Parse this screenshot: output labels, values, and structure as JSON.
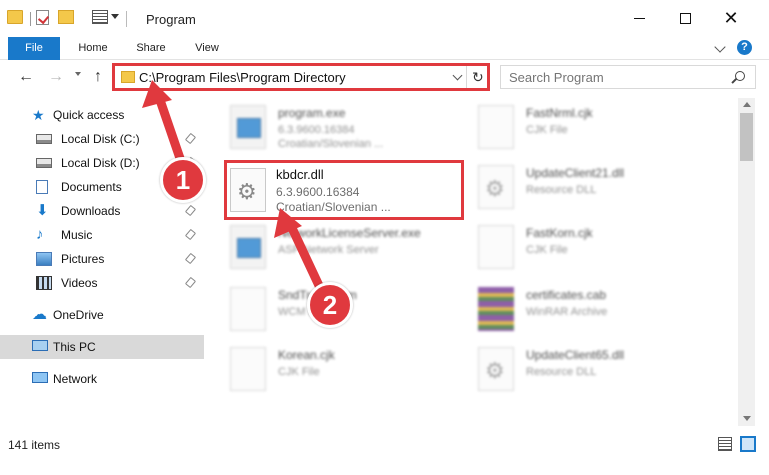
{
  "window": {
    "title": "Program",
    "minimize_glyph": "",
    "close_glyph": "✕"
  },
  "ribbon": {
    "tabs": [
      "File",
      "Home",
      "Share",
      "View"
    ],
    "help_glyph": "?"
  },
  "nav": {
    "back_glyph": "←",
    "forward_glyph": "→",
    "up_glyph": "↑",
    "address": "C:\\Program Files\\Program Directory",
    "refresh_glyph": "↻",
    "search_placeholder": "Search Program"
  },
  "sidebar": {
    "items": [
      {
        "label": "Quick access",
        "icon": "star-icon"
      },
      {
        "label": "Local Disk (C:)",
        "icon": "disk-icon"
      },
      {
        "label": "Local Disk (D:)",
        "icon": "disk-icon"
      },
      {
        "label": "Documents",
        "icon": "documents-icon"
      },
      {
        "label": "Downloads",
        "icon": "downloads-icon"
      },
      {
        "label": "Music",
        "icon": "music-icon"
      },
      {
        "label": "Pictures",
        "icon": "pictures-icon"
      },
      {
        "label": "Videos",
        "icon": "videos-icon"
      },
      {
        "label": "OneDrive",
        "icon": "onedrive-icon"
      },
      {
        "label": "This PC",
        "icon": "pc-icon"
      },
      {
        "label": "Network",
        "icon": "network-icon"
      }
    ]
  },
  "files": {
    "highlighted": {
      "name": "kbdcr.dll",
      "version": "6.3.9600.16384",
      "description": "Croatian/Slovenian ..."
    },
    "left": [
      {
        "name": "program.exe",
        "meta": "6.3.9600.16384",
        "meta2": "Croatian/Slovenian ..."
      },
      {
        "name": "NetworkLicenseServer.exe",
        "meta": "ASP Network Server",
        "meta2": ""
      },
      {
        "name": "SndTrack.wcm",
        "meta": "WCM File",
        "meta2": ""
      },
      {
        "name": "Korean.cjk",
        "meta": "CJK File",
        "meta2": ""
      }
    ],
    "right": [
      {
        "name": "FastNrml.cjk",
        "meta": "CJK File"
      },
      {
        "name": "UpdateClient21.dll",
        "meta": "Resource DLL"
      },
      {
        "name": "FastKorn.cjk",
        "meta": "CJK File"
      },
      {
        "name": "certificates.cab",
        "meta": "WinRAR Archive"
      },
      {
        "name": "UpdateClient65.dll",
        "meta": "Resource DLL"
      }
    ]
  },
  "status": {
    "item_count": "141 items"
  },
  "annotations": {
    "step1": "1",
    "step2": "2",
    "accent": "#e0393e"
  }
}
